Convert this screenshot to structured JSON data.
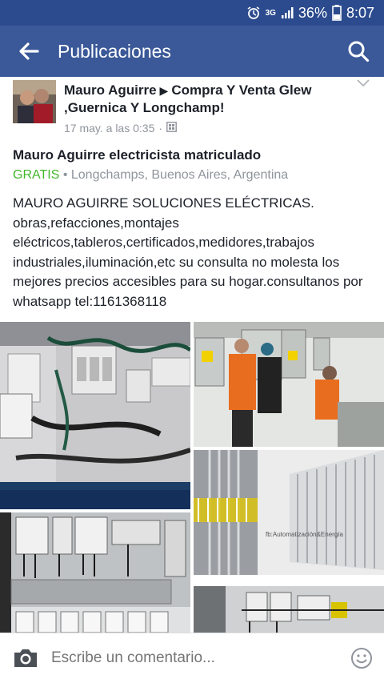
{
  "status_bar": {
    "network": "3G",
    "battery": "36%",
    "time": "8:07"
  },
  "app_bar": {
    "title": "Publicaciones"
  },
  "post": {
    "author": "Mauro Aguirre",
    "group": "Compra Y Venta Glew ,Guernica Y Longchamp!",
    "timestamp": "17 may. a las 0:35",
    "separator": "·",
    "listing_title": "Mauro Aguirre electricista matriculado",
    "price": "GRATIS",
    "location": "• Longchamps, Buenos Aires, Argentina",
    "body": "MAURO AGUIRRE SOLUCIONES ELÉCTRICAS.\nobras,refacciones,montajes eléctricos,tableros,certificados,medidores,trabajos industriales,iluminación,etc su consulta no molesta los mejores precios accesibles para su hogar.consultanos por whatsapp  tel:1161368118",
    "watermark": "fb:Automatización&Energía"
  },
  "comment_bar": {
    "placeholder": "Escribe un comentario..."
  },
  "colors": {
    "brand": "#3b5998",
    "status_bar": "#2c4b8e",
    "price_green": "#42b72a",
    "meta_gray": "#90949c"
  }
}
